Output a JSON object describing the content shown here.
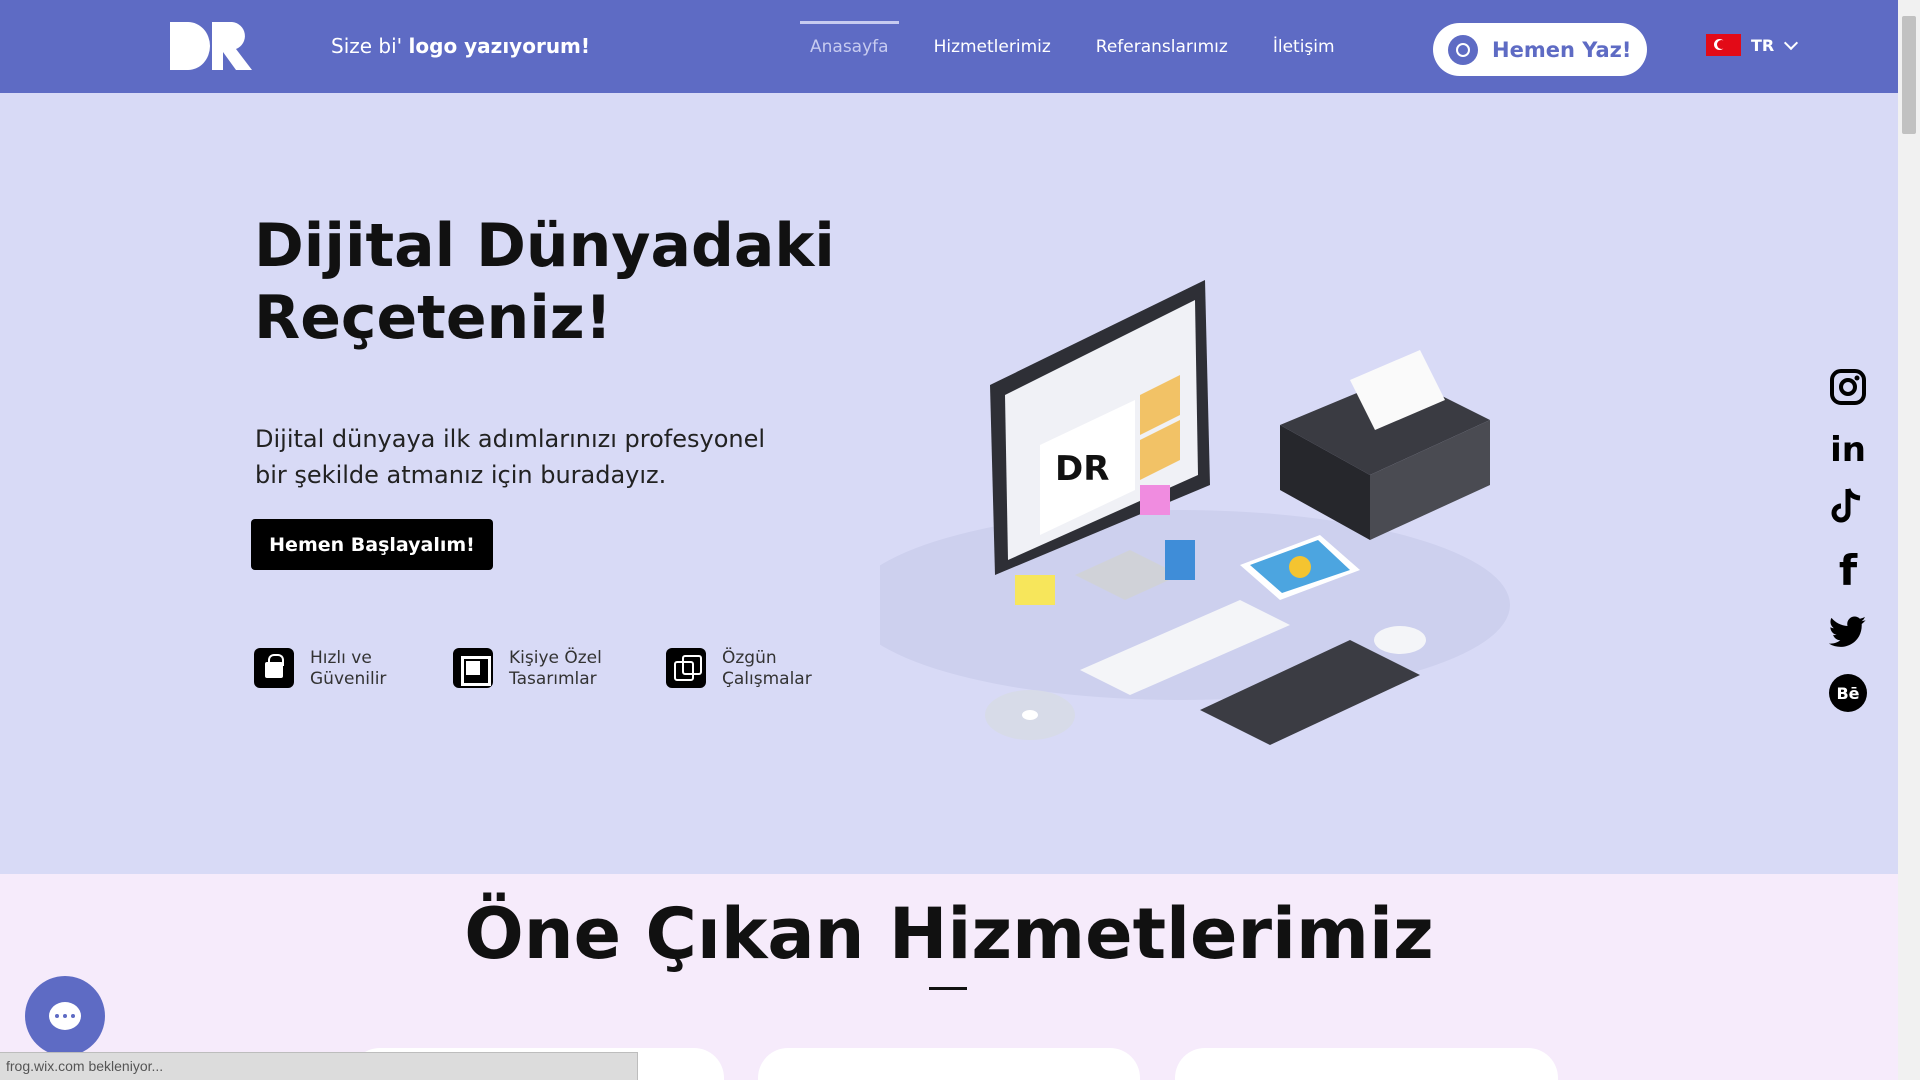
{
  "header": {
    "tagline_prefix": "Size bi'",
    "tagline_bold": "logo yazıyorum!",
    "nav": [
      {
        "label": "Anasayfa"
      },
      {
        "label": "Hizmetlerimiz"
      },
      {
        "label": "Referanslarımız"
      },
      {
        "label": "İletişim"
      }
    ],
    "cta_label": "Hemen Yaz!",
    "lang_code": "TR"
  },
  "hero": {
    "title_line1": "Dijital Dünyadaki",
    "title_line2": "Reçeteniz!",
    "subtitle_line1": "Dijital dünyaya ilk adımlarınızı profesyonel",
    "subtitle_line2": "bir şekilde atmanız için buradayız.",
    "button_label": "Hemen Başlayalım!",
    "features": [
      {
        "line1": "Hızlı ve",
        "line2": "Güvenilir"
      },
      {
        "line1": "Kişiye Özel",
        "line2": "Tasarımlar"
      },
      {
        "line1": "Özgün",
        "line2": "Çalışmalar"
      }
    ]
  },
  "social": {
    "linkedin": "in",
    "behance": "Bē",
    "facebook": "f"
  },
  "section2": {
    "title": "Öne Çıkan Hizmetlerimiz"
  },
  "status_text": "frog.wix.com bekleniyor...",
  "colors": {
    "header_bg": "#5e6bc4",
    "hero_bg": "#d8daf6",
    "section2_bg": "#f6ebfb"
  }
}
